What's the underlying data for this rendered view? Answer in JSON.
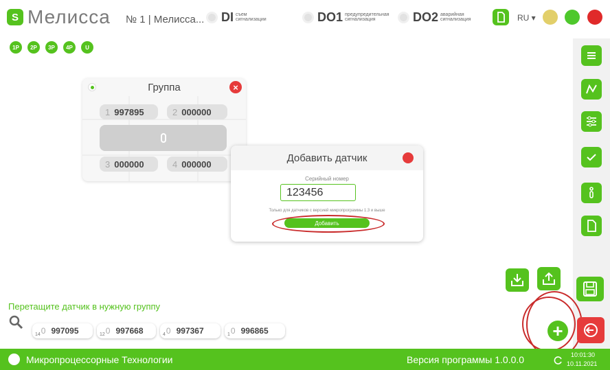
{
  "header": {
    "logo_badge": "S",
    "app_name": "Мелисса",
    "device_title": "№ 1 | Мелисса...",
    "signals": [
      {
        "code": "DI",
        "sub": "съем сигнализации"
      },
      {
        "code": "DO1",
        "sub": "предупредительная сигнализация"
      },
      {
        "code": "DO2",
        "sub": "аварийная сигнализация"
      }
    ],
    "language": "RU ▾",
    "status_colors": {
      "yellow": "#e2cf6a",
      "green": "#4ec82c",
      "red": "#e02a2a"
    }
  },
  "phases": [
    "1P",
    "2P",
    "3P",
    "4P",
    "U"
  ],
  "sidebar": {
    "icons": [
      "list-icon",
      "chart-icon",
      "settings-sliders-icon",
      "check-icon",
      "info-icon",
      "document-icon"
    ]
  },
  "group": {
    "title": "Группа",
    "close": "×",
    "slots": [
      {
        "index": "1",
        "serial": "997895"
      },
      {
        "index": "2",
        "serial": "000000"
      },
      {
        "index": "3",
        "serial": "000000"
      },
      {
        "index": "4",
        "serial": "000000"
      }
    ]
  },
  "dialog": {
    "title": "Добавить датчик",
    "serial_label": "Серийный номер",
    "serial_value": "123456",
    "note": "Только для датчиков с версией микропрограммы 1.3 и выше",
    "add_button": "Добавить"
  },
  "bottom": {
    "hint": "Перетащите датчик в нужную группу",
    "sensors": [
      {
        "sub": "14",
        "zero": "0",
        "serial": "997095"
      },
      {
        "sub": "12",
        "zero": "0",
        "serial": "997668"
      },
      {
        "sub": "4",
        "zero": "0",
        "serial": "997367"
      },
      {
        "sub": "1",
        "zero": "0",
        "serial": "996865"
      }
    ],
    "plus": "+"
  },
  "statusbar": {
    "company": "Микропроцессорные Технологии",
    "version": "Версия программы  1.0.0.0",
    "time": "10:01:30",
    "date": "10.11.2021"
  },
  "colors": {
    "accent": "#55c21e",
    "danger": "#e63b3b",
    "highlight": "#c92b2b"
  }
}
